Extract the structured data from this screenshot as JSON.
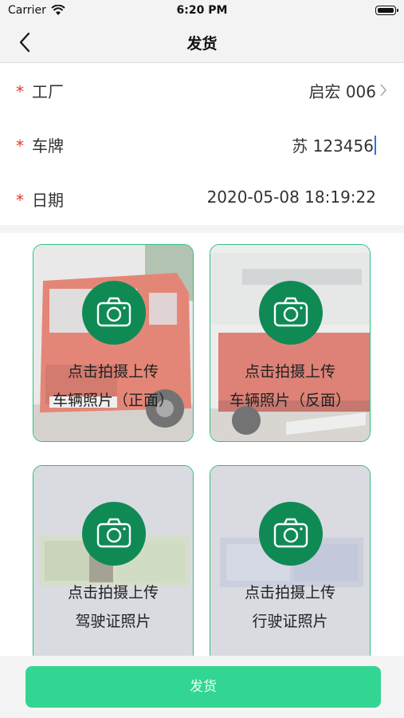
{
  "status_bar": {
    "carrier": "Carrier",
    "time": "6:20 PM"
  },
  "nav": {
    "title": "发货",
    "back_icon": "chevron-left-icon"
  },
  "form": {
    "required_mark": "*",
    "factory": {
      "label": "工厂",
      "value": "启宏 006"
    },
    "plate": {
      "label": "车牌",
      "value": "苏 123456"
    },
    "date": {
      "label": "日期",
      "value": "2020-05-08 18:19:22"
    }
  },
  "uploads": [
    {
      "line1": "点击拍摄上传",
      "line2": "车辆照片（正面）",
      "icon": "camera-icon"
    },
    {
      "line1": "点击拍摄上传",
      "line2": "车辆照片（反面）",
      "icon": "camera-icon"
    },
    {
      "line1": "点击拍摄上传",
      "line2": "驾驶证照片",
      "icon": "camera-icon"
    },
    {
      "line1": "点击拍摄上传",
      "line2": "行驶证照片",
      "icon": "camera-icon"
    }
  ],
  "submit": {
    "label": "发货"
  },
  "colors": {
    "accent": "#33d592",
    "card_border": "#2fbf7e",
    "camera_bg": "#0f8a55",
    "required": "#e03a2f"
  }
}
